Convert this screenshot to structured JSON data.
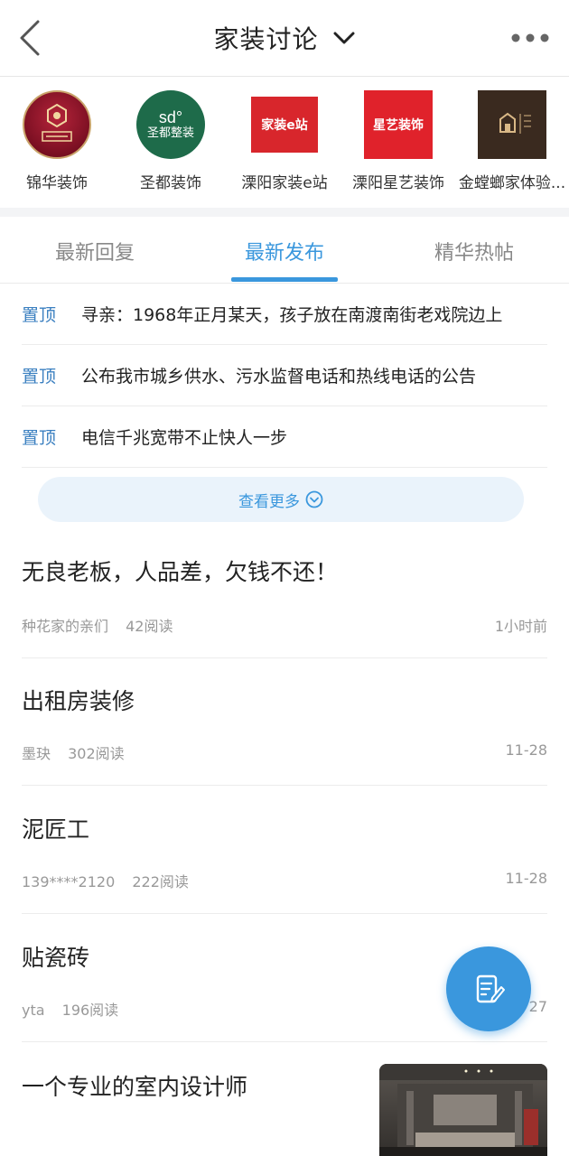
{
  "header": {
    "title": "家装讨论",
    "back_icon": "chevron-left-icon",
    "caret_icon": "chevron-down-icon",
    "more_icon": "more-horizontal-icon"
  },
  "brands": [
    {
      "name": "锦华装饰"
    },
    {
      "name": "圣都装饰",
      "logo_text_top": "sd°",
      "logo_text_bottom": "圣都整装"
    },
    {
      "name": "溧阳家装e站",
      "logo_text": "家装e站"
    },
    {
      "name": "溧阳星艺装饰",
      "logo_text": "星艺装饰"
    },
    {
      "name": "金螳螂家体验..."
    }
  ],
  "tabs": [
    {
      "label": "最新回复"
    },
    {
      "label": "最新发布"
    },
    {
      "label": "精华热帖"
    }
  ],
  "active_tab": "最新发布",
  "pinned": [
    {
      "tag": "置顶",
      "text": "寻亲：1968年正月某天，孩子放在南渡南街老戏院边上"
    },
    {
      "tag": "置顶",
      "text": "公布我市城乡供水、污水监督电话和热线电话的公告"
    },
    {
      "tag": "置顶",
      "text": "电信千兆宽带不止快人一步"
    }
  ],
  "see_more": {
    "label": "查看更多",
    "icon": "chevron-down-circle-icon"
  },
  "posts": [
    {
      "title": "无良老板，人品差，欠钱不还！",
      "author": "种花家的亲们",
      "reads": "42阅读",
      "time": "1小时前"
    },
    {
      "title": "出租房装修",
      "author": "墨玦",
      "reads": "302阅读",
      "time": "11-28"
    },
    {
      "title": "泥匠工",
      "author": "139****2120",
      "reads": "222阅读",
      "time": "11-28"
    },
    {
      "title": "贴瓷砖",
      "author": "yta",
      "reads": "196阅读",
      "time": "27"
    },
    {
      "title": "一个专业的室内设计师"
    }
  ],
  "fab_icon": "edit-note-icon",
  "colors": {
    "accent": "#3a97dd",
    "pin_tag": "#3a7fc0"
  }
}
